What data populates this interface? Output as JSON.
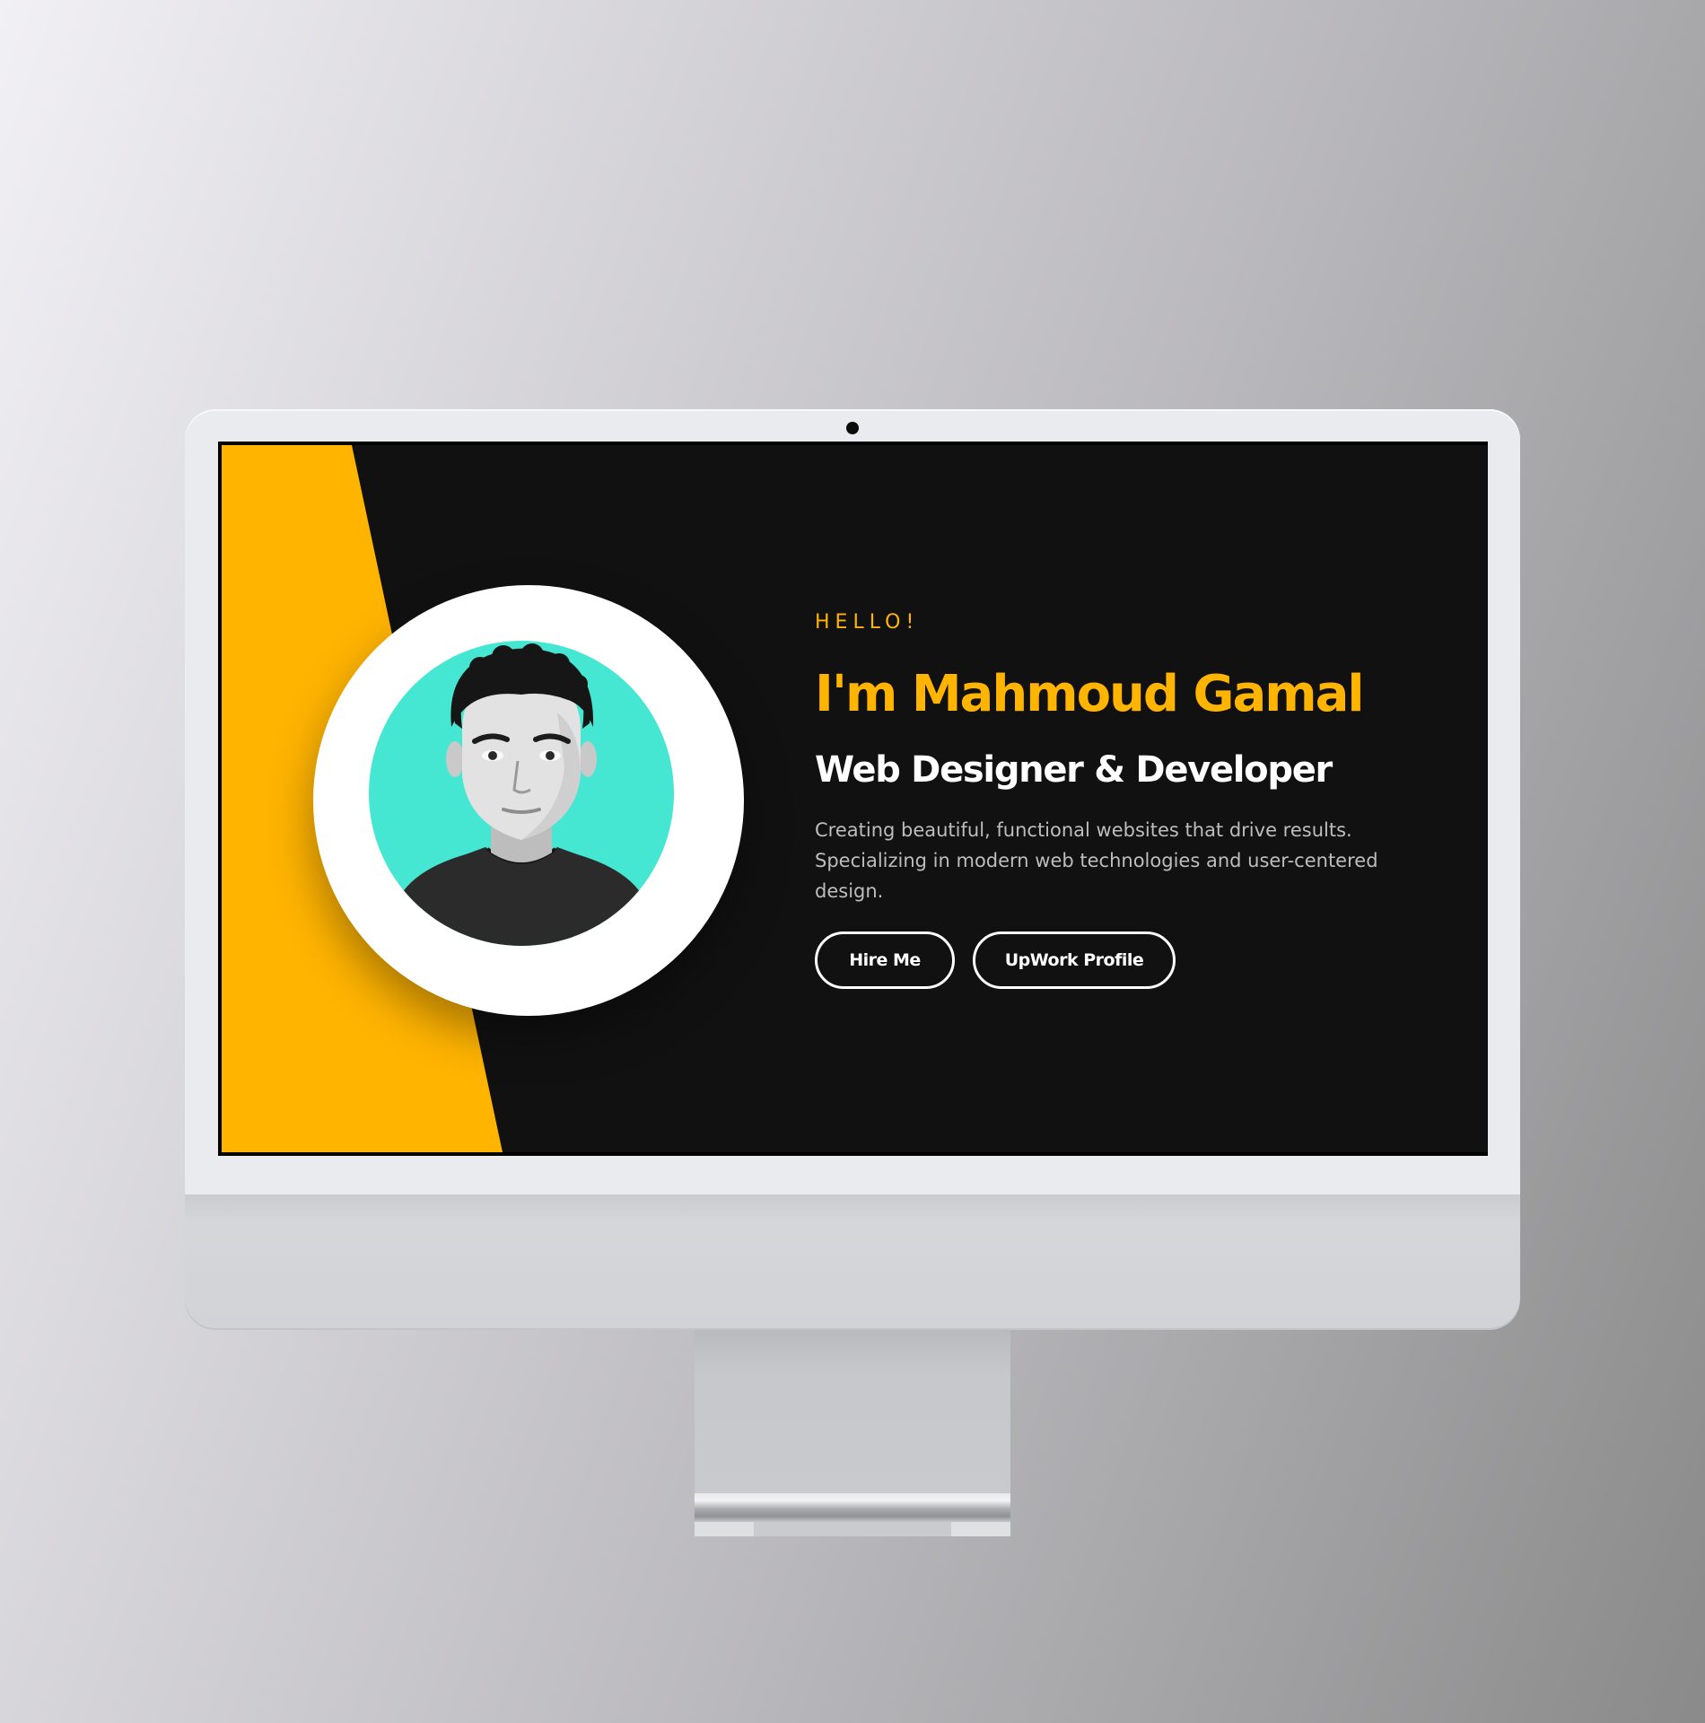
{
  "hero": {
    "greeting": "HELLO!",
    "name": "I'm Mahmoud Gamal",
    "role": "Web Designer & Developer",
    "description": "Creating beautiful, functional websites that drive results. Specializing in modern web technologies and user-centered design.",
    "buttons": {
      "hire_label": "Hire Me",
      "upwork_label": "UpWork Profile"
    }
  },
  "colors": {
    "accent": "#ffb400",
    "screen_background": "#111111",
    "portrait_background": "#45e6d2",
    "text_primary": "#ffffff",
    "text_secondary": "#bdbdbd"
  }
}
